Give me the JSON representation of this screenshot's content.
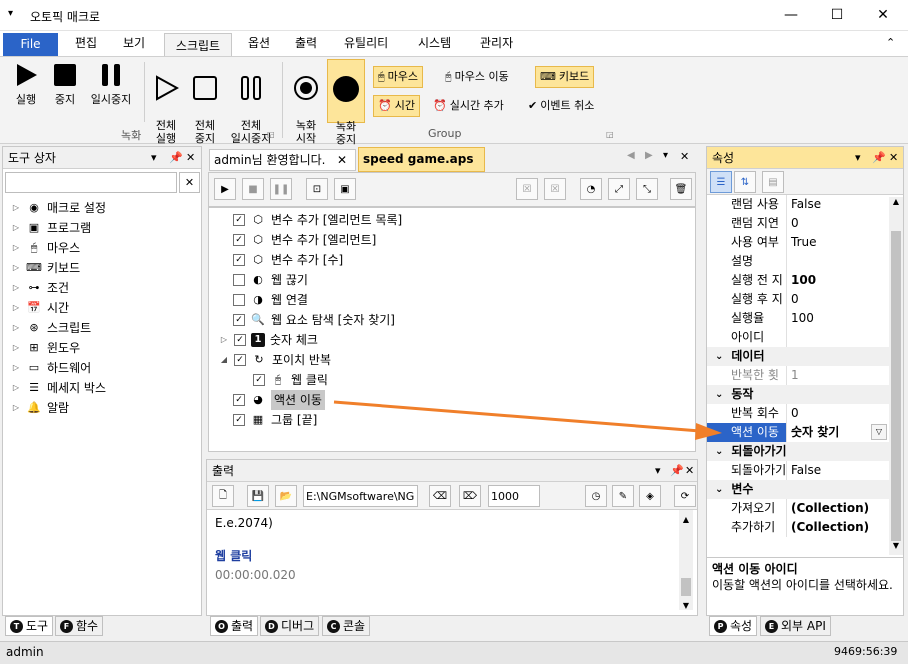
{
  "window": {
    "title": "오토픽 매크로",
    "minimize": "—",
    "maximize": "☐",
    "close": "✕",
    "menu_glyph": "▾"
  },
  "menu": {
    "items": [
      "File",
      "편집",
      "보기",
      "스크립트",
      "옵션",
      "출력",
      "유틸리티",
      "시스템",
      "관리자"
    ],
    "collapse": "⌃"
  },
  "ribbon": {
    "run": "실행",
    "stop": "중지",
    "pause": "일시중지",
    "run_all": "전체\n실행",
    "stop_all": "전체\n중지",
    "pause_all": "전체\n일시중지",
    "rec_start": "녹화\n시작",
    "rec_stop": "녹화\n중지",
    "group_record": "녹화",
    "group_group": "Group",
    "mouse": "마우스",
    "mouse_move": "마우스 이동",
    "keyboard": "키보드",
    "time": "시간",
    "realtime_add": "실시간 추가",
    "event_cancel": "이벤트 취소"
  },
  "toolbox": {
    "title": "도구 상자",
    "items": [
      "매크로 설정",
      "프로그램",
      "마우스",
      "키보드",
      "조건",
      "시간",
      "스크립트",
      "윈도우",
      "하드웨어",
      "메세지 박스",
      "알람"
    ],
    "tab_tool": "도구",
    "tab_func": "함수",
    "tab_tool_letter": "T",
    "tab_func_letter": "F"
  },
  "editor": {
    "tab1": "admin님 환영합니다.",
    "tab2": "speed game.aps",
    "rows": [
      "변수 추가 [엘리먼트 목록]",
      "변수 추가 [엘리먼트]",
      "변수 추가 [수]",
      "웹 끊기",
      "웹 연결",
      "웹 요소 탐색 [숫자 찾기]",
      "숫자 체크",
      "포이치 반복",
      "웹 클릭",
      "액션 이동",
      "그룹 [끝]"
    ]
  },
  "output": {
    "title": "출력",
    "path": "E:\\NGMsoftware\\NG",
    "number": "1000",
    "line1": "E.e.2074)",
    "line2": "웹 클릭",
    "line3": "00:00:00.020",
    "tab_out": "출력",
    "tab_debug": "디버그",
    "tab_console": "콘솔",
    "tab_out_letter": "O",
    "tab_debug_letter": "D",
    "tab_console_letter": "C"
  },
  "properties": {
    "title": "속성",
    "rows_top": [
      {
        "name": "랜덤 사용",
        "value": "False"
      },
      {
        "name": "랜덤 지연",
        "value": "0"
      },
      {
        "name": "사용 여부",
        "value": "True"
      },
      {
        "name": "설명",
        "value": ""
      },
      {
        "name": "실행 전 지",
        "value": "100"
      },
      {
        "name": "실행 후 지",
        "value": "0"
      },
      {
        "name": "실행율",
        "value": "100"
      },
      {
        "name": "아이디",
        "value": ""
      }
    ],
    "cat_data": "데이터",
    "data_rows": [
      {
        "name": "반복한 횟",
        "value": "1"
      }
    ],
    "cat_action": "동작",
    "action_rows": [
      {
        "name": "반복 회수",
        "value": "0"
      },
      {
        "name": "액션 이동",
        "value": "숫자 찾기"
      }
    ],
    "cat_back": "되돌아가기",
    "back_rows": [
      {
        "name": "되돌아가기",
        "value": "False"
      }
    ],
    "cat_var": "변수",
    "var_rows": [
      {
        "name": "가져오기",
        "value": "(Collection)"
      },
      {
        "name": "추가하기",
        "value": "(Collection)"
      }
    ],
    "desc_title": "액션 이동 아이디",
    "desc_text": "이동할 액션의 아이디를 선택하세요.",
    "tab_prop": "속성",
    "tab_api": "외부 API",
    "tab_prop_letter": "P",
    "tab_api_letter": "E"
  },
  "statusbar": {
    "user": "admin",
    "time": "9469:56:39"
  },
  "colors": {
    "accent": "#2b64c8",
    "highlight": "#fde59a",
    "arrow": "#f07f2a"
  }
}
